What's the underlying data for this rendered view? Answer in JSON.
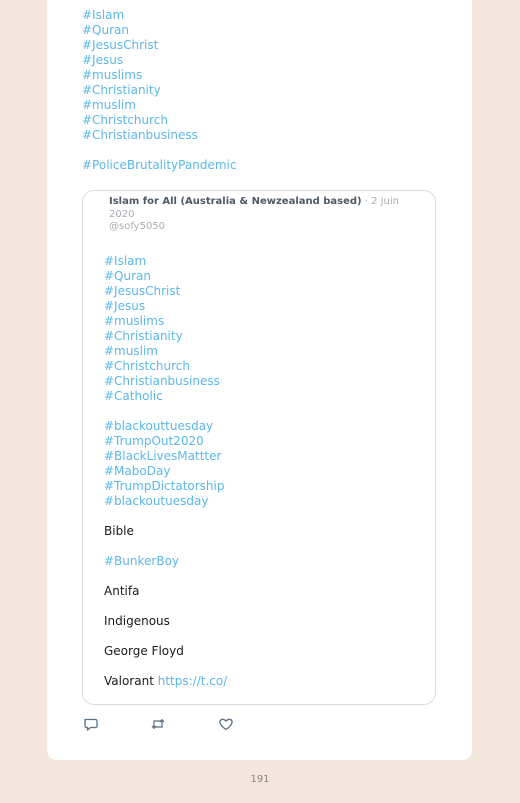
{
  "outer_hashtags": [
    "#Islam",
    "#Quran",
    "#JesusChrist",
    "#Jesus",
    "#muslims",
    "#Christianity",
    "#muslim",
    "#Christchurch",
    "#Christianbusiness"
  ],
  "outer_hashtag_extra": "#PoliceBrutalityPandemic",
  "quote": {
    "author": "Islam for All (Australia & Newzealand based)",
    "date": "· 2 juin 2020",
    "handle": "@sofy5050",
    "hashtags_1": [
      "#Islam",
      "#Quran",
      "#JesusChrist",
      "#Jesus",
      "#muslims",
      "#Christianity",
      "#muslim",
      "#Christchurch",
      "#Christianbusiness",
      "#Catholic"
    ],
    "hashtags_2": [
      "#blackouttuesday",
      "#TrumpOut2020",
      "#BlackLivesMattter",
      "#MaboDay",
      "#TrumpDictatorship",
      "#blackoutuesday"
    ],
    "bible": "Bible",
    "bunker": "#BunkerBoy",
    "antifa": "Antifa",
    "indigenous": "Indigenous",
    "floyd": "George Floyd",
    "valorant": "Valorant",
    "link": "https://t.co/"
  },
  "actions": {
    "reply_icon": "reply-icon",
    "retweet_icon": "retweet-icon",
    "like_icon": "heart-icon"
  },
  "page_number": "191",
  "colors": {
    "background": "#f3e7dc",
    "card": "#ffffff",
    "link": "#5bb8e8",
    "text": "#1a1a1a"
  }
}
